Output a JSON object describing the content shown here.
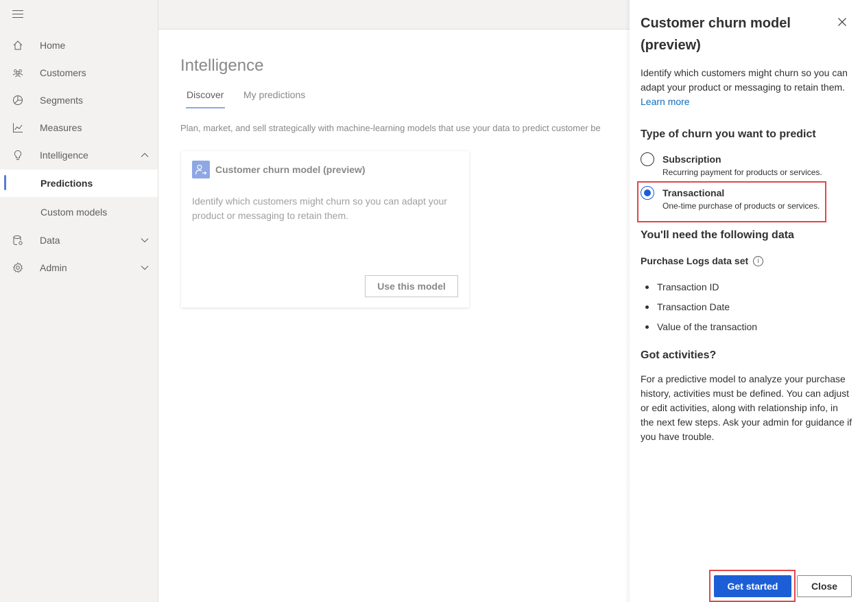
{
  "sidebar": {
    "items": [
      {
        "label": "Home",
        "icon": "home-icon"
      },
      {
        "label": "Customers",
        "icon": "people-icon"
      },
      {
        "label": "Segments",
        "icon": "pie-chart-icon"
      },
      {
        "label": "Measures",
        "icon": "line-chart-icon"
      },
      {
        "label": "Intelligence",
        "icon": "lightbulb-icon",
        "expanded": true
      },
      {
        "label": "Predictions",
        "active": true
      },
      {
        "label": "Custom models"
      },
      {
        "label": "Data",
        "icon": "database-icon"
      },
      {
        "label": "Admin",
        "icon": "gear-icon"
      }
    ]
  },
  "main": {
    "title": "Intelligence",
    "tabs": [
      {
        "label": "Discover",
        "active": true
      },
      {
        "label": "My predictions"
      }
    ],
    "description": "Plan, market, and sell strategically with machine-learning models that use your data to predict customer be",
    "card": {
      "title": "Customer churn model (preview)",
      "body": "Identify which customers might churn so you can adapt your product or messaging to retain them.",
      "button": "Use this model"
    }
  },
  "panel": {
    "title": "Customer churn model (preview)",
    "description": "Identify which customers might churn so you can adapt your product or messaging to retain them.",
    "learn_more": "Learn more",
    "churn_heading": "Type of churn you want to predict",
    "options": [
      {
        "label": "Subscription",
        "sub": "Recurring payment for products or services.",
        "selected": false
      },
      {
        "label": "Transactional",
        "sub": "One-time purchase of products or services.",
        "selected": true
      }
    ],
    "data_heading": "You'll need the following data",
    "dataset_label": "Purchase Logs data set",
    "info_glyph": "i",
    "fields": [
      "Transaction ID",
      "Transaction Date",
      "Value of the transaction"
    ],
    "activities_heading": "Got activities?",
    "activities_text": "For a predictive model to analyze your purchase history, activities must be defined. You can adjust or edit activities, along with relationship info, in the next few steps. Ask your admin for guidance if you have trouble.",
    "get_started": "Get started",
    "close": "Close"
  },
  "colors": {
    "accent": "#1b5ed6",
    "highlight": "#e0464a",
    "link": "#0f6cbd"
  }
}
